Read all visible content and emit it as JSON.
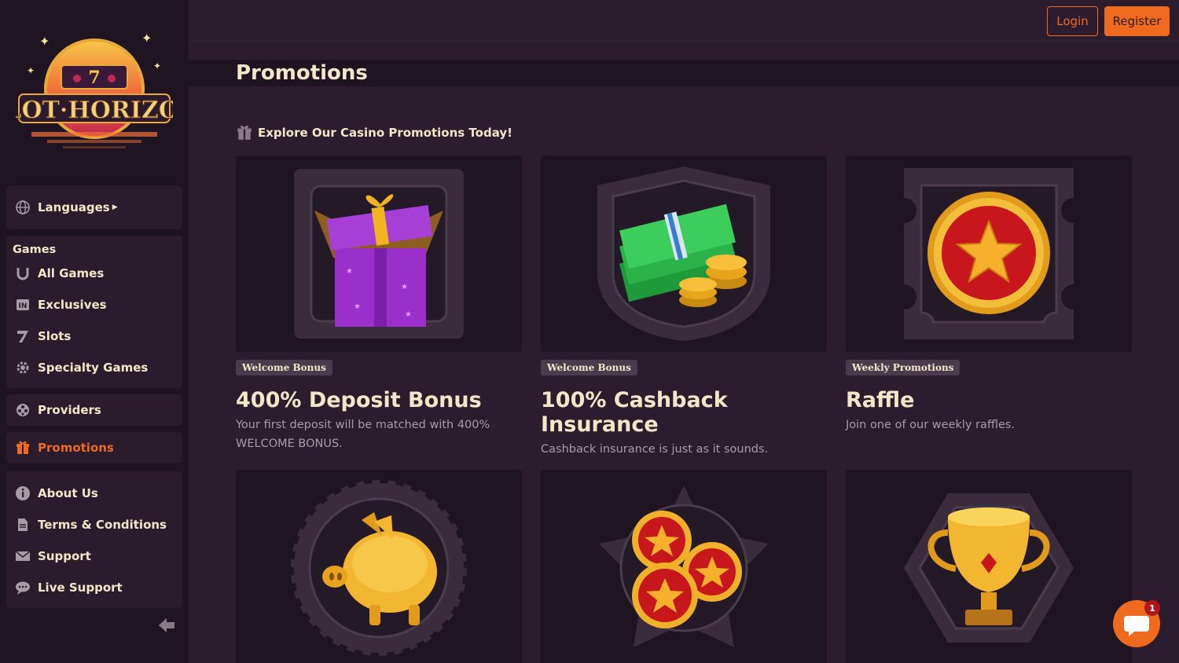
{
  "brand": {
    "logo_text": "SLOT·HORIZON",
    "accent": "#ef6a1f",
    "background": "#2b1d2e",
    "panel": "#1f1522"
  },
  "header": {
    "login_label": "Login",
    "register_label": "Register"
  },
  "sidebar": {
    "languages_label": "Languages",
    "games_heading": "Games",
    "games_items": [
      {
        "label": "All Games",
        "icon": "horseshoe-icon"
      },
      {
        "label": "Exclusives",
        "icon": "exclusive-badge-icon"
      },
      {
        "label": "Slots",
        "icon": "seven-icon"
      },
      {
        "label": "Specialty Games",
        "icon": "gear-icon"
      }
    ],
    "providers_label": "Providers",
    "promotions_label": "Promotions",
    "info_items": [
      {
        "label": "About Us",
        "icon": "info-icon"
      },
      {
        "label": "Terms & Conditions",
        "icon": "document-icon"
      },
      {
        "label": "Support",
        "icon": "envelope-icon"
      },
      {
        "label": "Live Support",
        "icon": "chat-icon"
      }
    ]
  },
  "page": {
    "title": "Promotions",
    "subtitle": "Explore Our Casino Promotions Today!"
  },
  "promotions": [
    {
      "tag": "Welcome Bonus",
      "title": "400% Deposit Bonus",
      "description": "Your first deposit will be matched with 400% WELCOME BONUS.",
      "image": "gift-box-icon"
    },
    {
      "tag": "Welcome Bonus",
      "title": "100% Cashback Insurance",
      "description": "Cashback insurance is just as it sounds.",
      "image": "cash-stack-icon"
    },
    {
      "tag": "Weekly Promotions",
      "title": "Raffle",
      "description": "Join one of our weekly raffles.",
      "image": "star-coin-icon"
    },
    {
      "image": "piggy-bank-icon"
    },
    {
      "image": "star-coins-icon"
    },
    {
      "image": "trophy-icon"
    }
  ],
  "chat": {
    "badge_count": "1"
  }
}
